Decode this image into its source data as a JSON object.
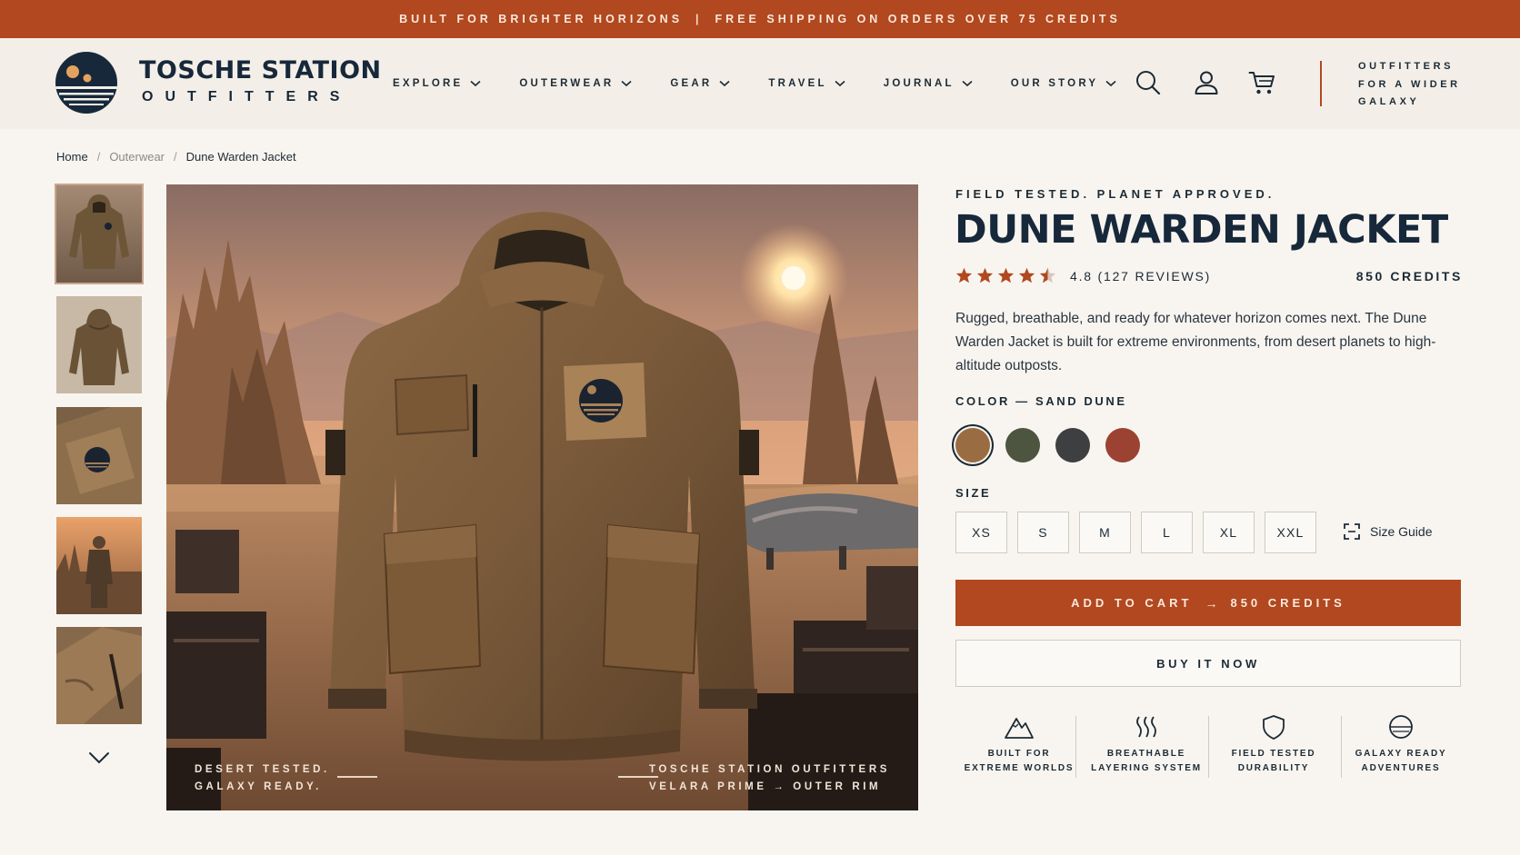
{
  "announcement": {
    "left": "BUILT FOR BRIGHTER HORIZONS",
    "separator": "|",
    "right": "FREE SHIPPING ON ORDERS OVER 75 CREDITS"
  },
  "brand": {
    "name": "TOSCHE STATION",
    "sub": "OUTFITTERS",
    "tagline_lines": [
      "OUTFITTERS",
      "FOR A WIDER",
      "GALAXY"
    ]
  },
  "nav": [
    {
      "label": "EXPLORE"
    },
    {
      "label": "OUTERWEAR"
    },
    {
      "label": "GEAR"
    },
    {
      "label": "TRAVEL"
    },
    {
      "label": "JOURNAL"
    },
    {
      "label": "OUR STORY"
    }
  ],
  "header_icons": [
    "search-icon",
    "account-icon",
    "cart-icon"
  ],
  "breadcrumb": {
    "home": "Home",
    "category": "Outerwear",
    "current": "Dune Warden Jacket",
    "separator": "/"
  },
  "gallery": {
    "thumbnails": [
      "jacket-front",
      "jacket-back",
      "chest-patch",
      "model-wearing",
      "fabric-detail"
    ],
    "caption_left": [
      "DESERT TESTED.",
      "GALAXY READY."
    ],
    "caption_right": [
      "TOSCHE STATION OUTFITTERS",
      "VELARA PRIME → OUTER RIM"
    ]
  },
  "product": {
    "eyebrow": "FIELD TESTED. PLANET APPROVED.",
    "title": "DUNE WARDEN JACKET",
    "rating": 4.8,
    "rating_text": "4.8 (127 REVIEWS)",
    "price": "850 CREDITS",
    "description": "Rugged, breathable, and ready for whatever horizon comes next. The Dune Warden Jacket is built for extreme environments, from desert planets to high-altitude outposts.",
    "color_label": "COLOR — SAND DUNE",
    "colors": [
      {
        "name": "sand-dune",
        "hex": "#9a6c42",
        "selected": true
      },
      {
        "name": "olive",
        "hex": "#4d5440",
        "selected": false
      },
      {
        "name": "charcoal",
        "hex": "#3e3f41",
        "selected": false
      },
      {
        "name": "rust",
        "hex": "#9b4233",
        "selected": false
      }
    ],
    "size_label": "SIZE",
    "sizes": [
      "XS",
      "S",
      "M",
      "L",
      "XL",
      "XXL"
    ],
    "size_guide": "Size Guide",
    "add_to_cart": "ADD TO CART",
    "add_to_cart_arrow": "→",
    "add_to_cart_price": "850 CREDITS",
    "buy_now": "BUY IT NOW",
    "features": [
      {
        "icon": "mountain-icon",
        "line1": "BUILT FOR",
        "line2": "EXTREME WORLDS"
      },
      {
        "icon": "heat-waves-icon",
        "line1": "BREATHABLE",
        "line2": "LAYERING SYSTEM"
      },
      {
        "icon": "shield-icon",
        "line1": "FIELD TESTED",
        "line2": "DURABILITY"
      },
      {
        "icon": "planet-icon",
        "line1": "GALAXY READY",
        "line2": "ADVENTURES"
      }
    ]
  },
  "colors": {
    "accent": "#b1481f",
    "navy": "#17283a",
    "background": "#f8f5f0"
  }
}
